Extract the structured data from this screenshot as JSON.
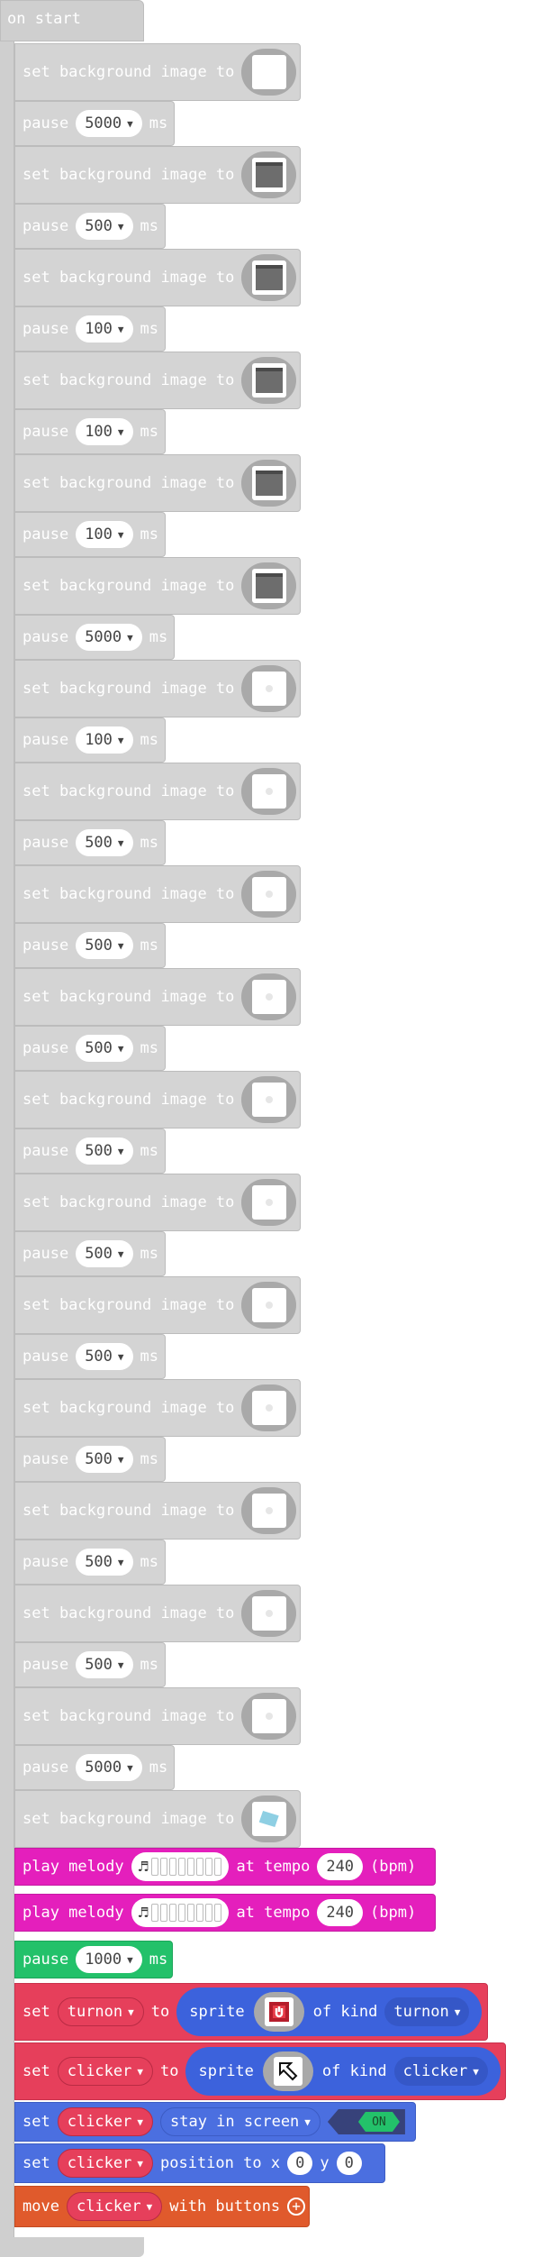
{
  "hat": {
    "label": "on start"
  },
  "labels": {
    "set_bg": "set background image to",
    "pause": "pause",
    "ms": "ms",
    "play_melody": "play melody",
    "at_tempo": "at tempo",
    "bpm": "(bpm)",
    "set": "set",
    "to": "to",
    "sprite": "sprite",
    "of_kind": "of kind",
    "position_to_x": "position to x",
    "y": "y",
    "move": "move",
    "with_buttons": "with buttons"
  },
  "sequence": [
    {
      "type": "bg",
      "img": "white"
    },
    {
      "type": "pause",
      "value": "5000"
    },
    {
      "type": "bg",
      "img": "dark"
    },
    {
      "type": "pause",
      "value": "500"
    },
    {
      "type": "bg",
      "img": "dark"
    },
    {
      "type": "pause",
      "value": "100"
    },
    {
      "type": "bg",
      "img": "dark"
    },
    {
      "type": "pause",
      "value": "100"
    },
    {
      "type": "bg",
      "img": "dark"
    },
    {
      "type": "pause",
      "value": "100"
    },
    {
      "type": "bg",
      "img": "dark"
    },
    {
      "type": "pause",
      "value": "5000"
    },
    {
      "type": "bg",
      "img": "dot"
    },
    {
      "type": "pause",
      "value": "100"
    },
    {
      "type": "bg",
      "img": "dot"
    },
    {
      "type": "pause",
      "value": "500"
    },
    {
      "type": "bg",
      "img": "dot"
    },
    {
      "type": "pause",
      "value": "500"
    },
    {
      "type": "bg",
      "img": "dot"
    },
    {
      "type": "pause",
      "value": "500"
    },
    {
      "type": "bg",
      "img": "dot"
    },
    {
      "type": "pause",
      "value": "500"
    },
    {
      "type": "bg",
      "img": "dot"
    },
    {
      "type": "pause",
      "value": "500"
    },
    {
      "type": "bg",
      "img": "dot"
    },
    {
      "type": "pause",
      "value": "500"
    },
    {
      "type": "bg",
      "img": "dot"
    },
    {
      "type": "pause",
      "value": "500"
    },
    {
      "type": "bg",
      "img": "dot"
    },
    {
      "type": "pause",
      "value": "500"
    },
    {
      "type": "bg",
      "img": "dot"
    },
    {
      "type": "pause",
      "value": "500"
    },
    {
      "type": "bg",
      "img": "dot"
    },
    {
      "type": "pause",
      "value": "5000"
    },
    {
      "type": "bg",
      "img": "teal"
    }
  ],
  "melodies": [
    {
      "tempo": "240"
    },
    {
      "tempo": "240"
    }
  ],
  "green_pause": {
    "value": "1000"
  },
  "set_turnon": {
    "var": "turnon",
    "kind": "turnon"
  },
  "set_clicker": {
    "var": "clicker",
    "kind": "clicker"
  },
  "stay": {
    "var": "clicker",
    "flag": "stay in screen",
    "toggle": "ON"
  },
  "position": {
    "var": "clicker",
    "x": "0",
    "y": "0"
  },
  "move": {
    "var": "clicker"
  },
  "colors": {
    "gray_block": "#d4d4d4",
    "melody": "#e41fbc",
    "pause_green": "#23c16a",
    "variables_red": "#e63f5b",
    "sprites_blue": "#4b6fe0",
    "controller_orange": "#e05a2c"
  }
}
